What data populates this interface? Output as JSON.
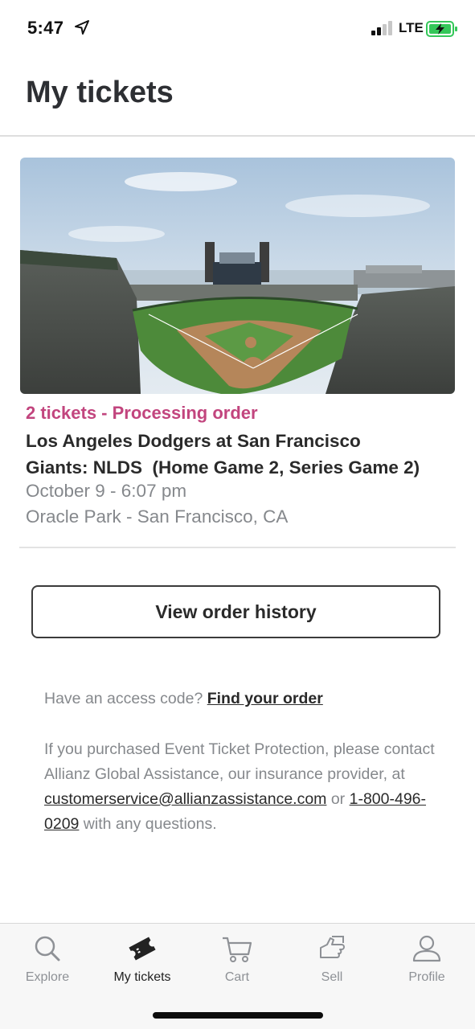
{
  "status_bar": {
    "time": "5:47",
    "network": "LTE",
    "icons": [
      "location-arrow-icon",
      "cellular-signal-icon",
      "battery-charging-icon"
    ]
  },
  "header": {
    "title": "My tickets"
  },
  "ticket": {
    "image_subject": "stadium-photo",
    "status": "2 tickets - Processing order",
    "status_color": "#c2457e",
    "title_lines": [
      "Los Angeles Dodgers at San Francisco",
      "Giants: NLDS  (Home Game 2, Series Game 2)"
    ],
    "datetime": "October 9 - 6:07 pm",
    "venue": "Oracle Park - San Francisco, CA"
  },
  "actions": {
    "view_history_label": "View order history"
  },
  "help": {
    "access_code_prompt": "Have an access code? ",
    "find_order_link": "Find your order",
    "protection_text_before": "If you purchased Event Ticket Protection, please contact Allianz Global Assistance, our insurance provider, at ",
    "email": "customerservice@allianzassistance.com",
    "or_text": " or ",
    "phone": "1-800-496-0209",
    "protection_text_after": " with any questions."
  },
  "tab_bar": {
    "items": [
      {
        "label": "Explore",
        "icon": "search-icon",
        "active": false
      },
      {
        "label": "My tickets",
        "icon": "ticket-icon",
        "active": true
      },
      {
        "label": "Cart",
        "icon": "cart-icon",
        "active": false
      },
      {
        "label": "Sell",
        "icon": "sell-icon",
        "active": false
      },
      {
        "label": "Profile",
        "icon": "profile-icon",
        "active": false
      }
    ],
    "active_color": "#222222",
    "inactive_color": "#8e9196"
  }
}
